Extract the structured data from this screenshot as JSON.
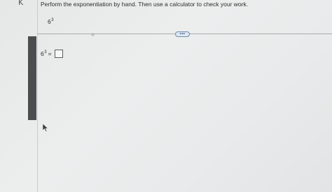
{
  "header": {
    "corner_mark": "K"
  },
  "question": {
    "instruction": "Perform the exponentiation by hand. Then use a calculator to check your work.",
    "base": "6",
    "exponent": "3"
  },
  "toolbar": {
    "more_label": "•••"
  },
  "answer": {
    "base": "6",
    "exponent": "3",
    "equals": "=",
    "value": ""
  }
}
